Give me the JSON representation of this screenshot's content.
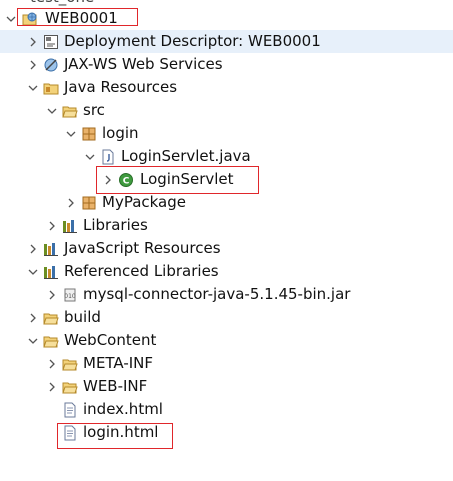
{
  "partial_top_label": "test_one",
  "tree": [
    {
      "label": "WEB0001",
      "expanded": true
    },
    {
      "label": "Deployment Descriptor: WEB0001",
      "expanded": false
    },
    {
      "label": "JAX-WS Web Services",
      "expanded": false
    },
    {
      "label": "Java Resources",
      "expanded": true
    },
    {
      "label": "src",
      "expanded": true
    },
    {
      "label": "login",
      "expanded": true
    },
    {
      "label": "LoginServlet.java",
      "expanded": true
    },
    {
      "label": "LoginServlet",
      "expanded": false
    },
    {
      "label": "MyPackage",
      "expanded": false
    },
    {
      "label": "Libraries",
      "expanded": false
    },
    {
      "label": "JavaScript Resources",
      "expanded": false
    },
    {
      "label": "Referenced Libraries",
      "expanded": true
    },
    {
      "label": "mysql-connector-java-5.1.45-bin.jar",
      "expanded": false
    },
    {
      "label": "build",
      "expanded": false
    },
    {
      "label": "WebContent",
      "expanded": true
    },
    {
      "label": "META-INF",
      "expanded": false
    },
    {
      "label": "WEB-INF",
      "expanded": false
    },
    {
      "label": "index.html"
    },
    {
      "label": "login.html"
    }
  ],
  "colors": {
    "highlight_box": "#e0272b",
    "selection": "#e7f0fa",
    "folder": "#e9b949",
    "package": "#c98a2b",
    "class_green": "#3f9b3f"
  }
}
